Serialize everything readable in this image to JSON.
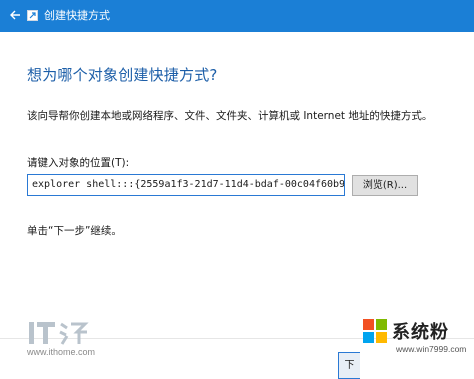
{
  "window": {
    "title": "创建快捷方式",
    "back_icon": "back-arrow-icon",
    "app_icon": "shortcut-icon"
  },
  "main": {
    "heading": "想为哪个对象创建快捷方式?",
    "description": "该向导帮你创建本地或网络程序、文件、文件夹、计算机或 Internet 地址的快捷方式。",
    "location_label": "请键入对象的位置(T):",
    "location_value": "explorer shell:::{2559a1f3-21d7-11d4-bdaf-00c04f60b9f0}",
    "browse_label": "浏览(R)...",
    "hint": "单击“下一步”继续。"
  },
  "footer": {
    "next_label": "下"
  },
  "watermarks": {
    "ithome_url": "www.ithome.com",
    "site_name": "系统粉",
    "site_url": "www.win7999.com"
  },
  "colors": {
    "titlebar": "#1b7fd6",
    "heading": "#1c5ea8",
    "input_border": "#2a79d4"
  }
}
